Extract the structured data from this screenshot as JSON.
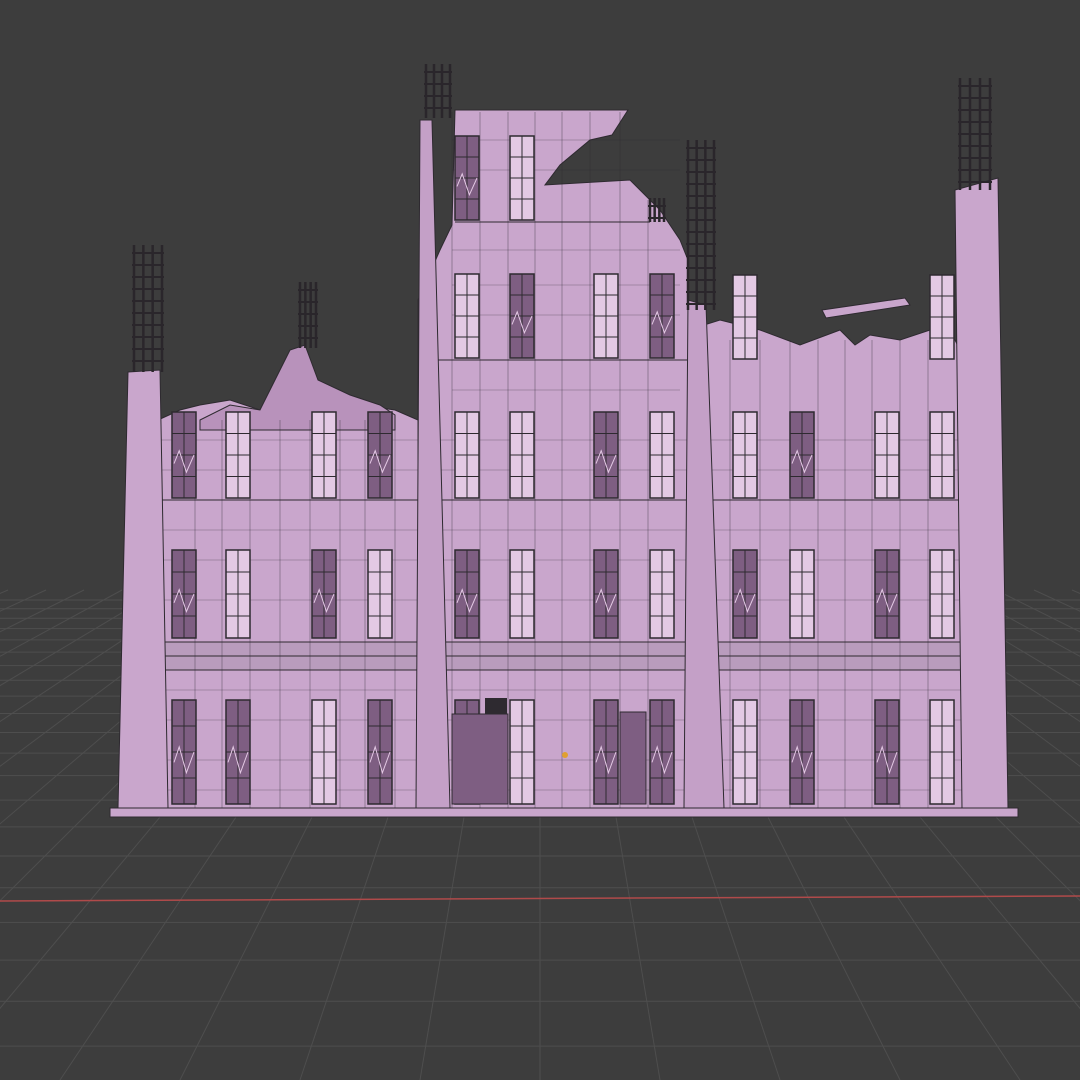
{
  "viewport": {
    "background_color": "#3d3d3d",
    "grid_line_color": "#4e4e4e",
    "x_axis_color": "#b04a4a",
    "model_color": "#c9a6cc",
    "model_dark_color": "#7e5e82",
    "wire_color": "#2e2a30",
    "window_color": "#e3c9e4",
    "origin_dot_color": "#e0a030"
  },
  "model": {
    "object": "ruined-building",
    "shading": "solid-with-wireframe"
  }
}
